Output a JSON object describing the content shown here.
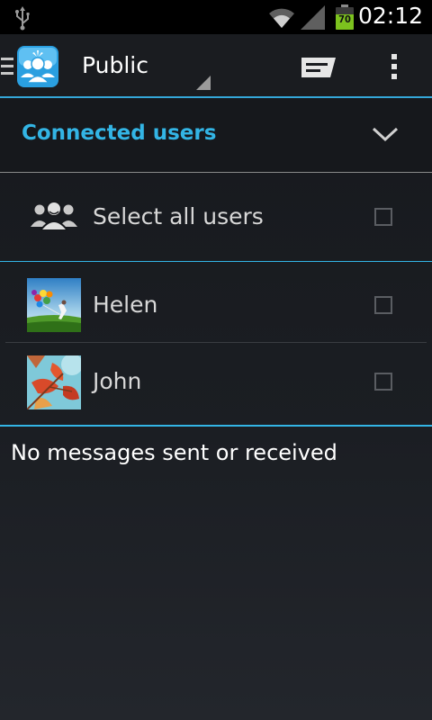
{
  "status_bar": {
    "time": "02:12",
    "battery_level": "70",
    "battery_fraction": 0.7,
    "icons": [
      "usb-icon",
      "wifi-icon",
      "signal-icon",
      "battery-icon"
    ]
  },
  "action_bar": {
    "title": "Public",
    "icons": [
      "drawer-icon",
      "app-icon",
      "compose-icon",
      "overflow-menu-icon"
    ]
  },
  "section": {
    "title": "Connected users",
    "accent_color": "#33b5e5"
  },
  "select_all": {
    "label": "Select all users",
    "checked": false
  },
  "users": [
    {
      "name": "Helen",
      "checked": false,
      "avatar": "balloons-photo"
    },
    {
      "name": "John",
      "checked": false,
      "avatar": "autumn-leaves-photo"
    }
  ],
  "messages": {
    "empty_text": "No messages sent or received"
  }
}
